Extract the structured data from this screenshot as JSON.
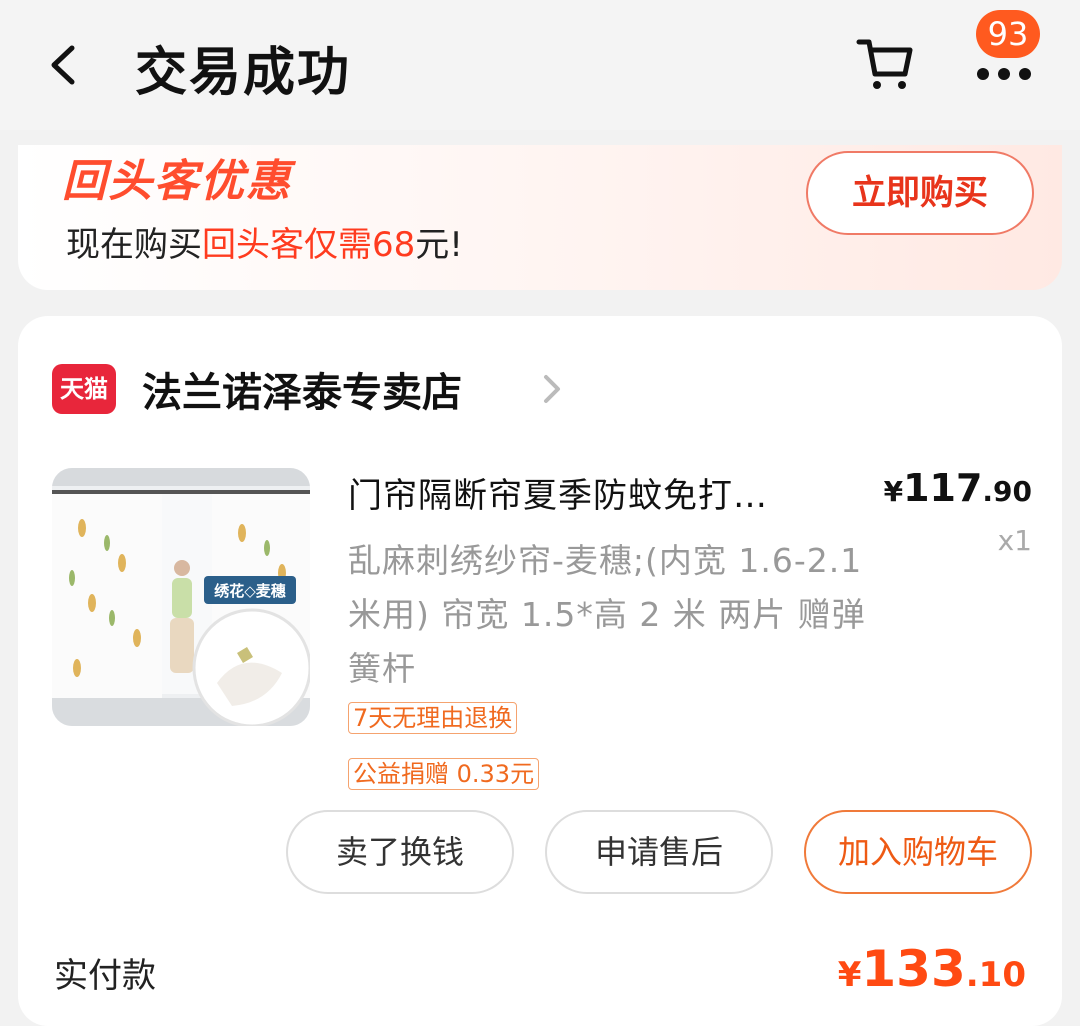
{
  "nav": {
    "title": "交易成功",
    "badge_count": "93",
    "icons": [
      "back-icon",
      "cart-icon",
      "more-icon"
    ]
  },
  "promo": {
    "title": "回头客优惠",
    "text_prefix": "现在购买",
    "text_highlight": "回头客仅需",
    "amount": "68",
    "text_suffix": "元!",
    "button_label": "立即购买"
  },
  "shop": {
    "logo_text": "天猫",
    "name": "法兰诺泽泰专卖店"
  },
  "product": {
    "title": "门帘隔断帘夏季防蚊免打…",
    "price_currency": "¥",
    "price_int": "117",
    "price_dec": ".90",
    "qty": "x1",
    "variant": "乱麻刺绣纱帘-麦穗;(内宽 1.6-2.1米用) 帘宽 1.5*高 2 米 两片 赠弹簧杆",
    "image_label": "绣花◇麦穗",
    "tags": [
      "7天无理由退换",
      "公益捐赠 0.33元"
    ]
  },
  "actions": {
    "sell": "卖了换钱",
    "aftersale": "申请售后",
    "add_cart": "加入购物车"
  },
  "payment": {
    "label": "实付款",
    "currency": "¥",
    "int": "133",
    "dec": ".10"
  },
  "colors": {
    "accent": "#ff4a12",
    "badge": "#ff5a1f",
    "tmall_red": "#e8263b"
  }
}
